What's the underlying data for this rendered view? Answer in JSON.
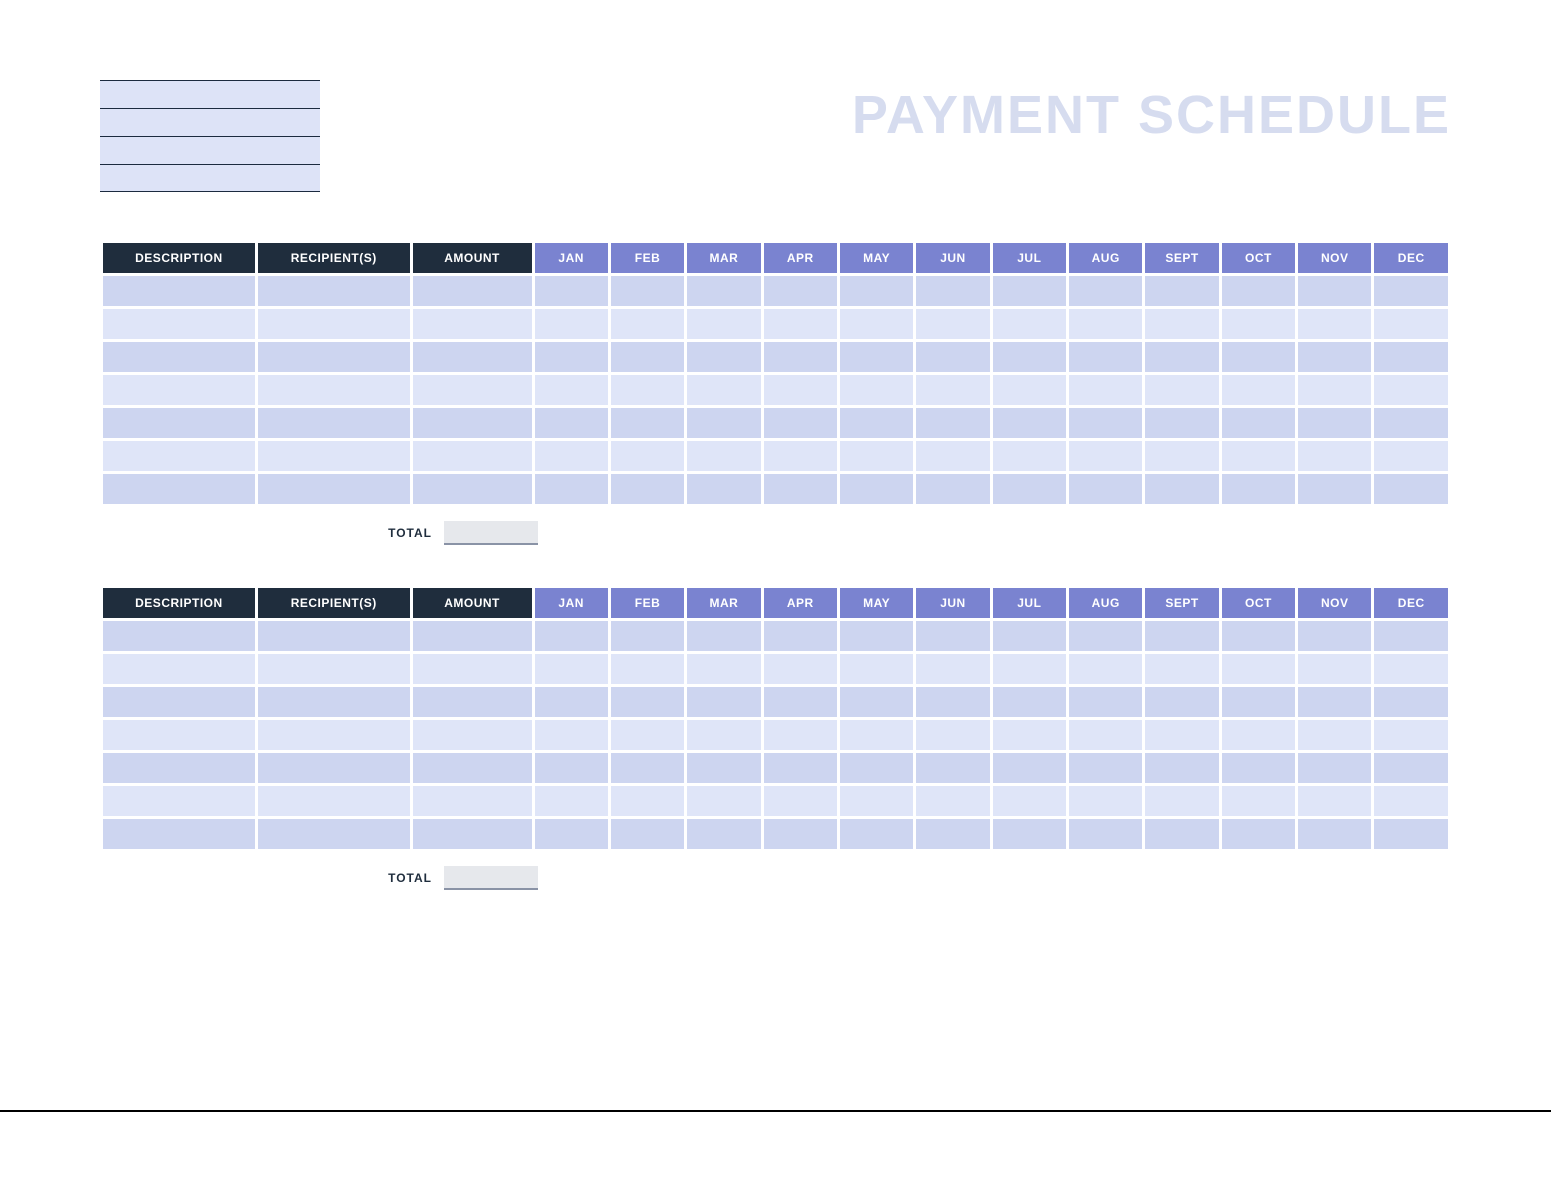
{
  "title": "PAYMENT SCHEDULE",
  "info_lines": [
    "",
    "",
    "",
    ""
  ],
  "columns": {
    "description": "DESCRIPTION",
    "recipients": "RECIPIENT(S)",
    "amount": "AMOUNT",
    "months": [
      "JAN",
      "FEB",
      "MAR",
      "APR",
      "MAY",
      "JUN",
      "JUL",
      "AUG",
      "SEPT",
      "OCT",
      "NOV",
      "DEC"
    ]
  },
  "tables": [
    {
      "rows": [
        {
          "description": "",
          "recipients": "",
          "amount": "",
          "months": [
            "",
            "",
            "",
            "",
            "",
            "",
            "",
            "",
            "",
            "",
            "",
            ""
          ]
        },
        {
          "description": "",
          "recipients": "",
          "amount": "",
          "months": [
            "",
            "",
            "",
            "",
            "",
            "",
            "",
            "",
            "",
            "",
            "",
            ""
          ]
        },
        {
          "description": "",
          "recipients": "",
          "amount": "",
          "months": [
            "",
            "",
            "",
            "",
            "",
            "",
            "",
            "",
            "",
            "",
            "",
            ""
          ]
        },
        {
          "description": "",
          "recipients": "",
          "amount": "",
          "months": [
            "",
            "",
            "",
            "",
            "",
            "",
            "",
            "",
            "",
            "",
            "",
            ""
          ]
        },
        {
          "description": "",
          "recipients": "",
          "amount": "",
          "months": [
            "",
            "",
            "",
            "",
            "",
            "",
            "",
            "",
            "",
            "",
            "",
            ""
          ]
        },
        {
          "description": "",
          "recipients": "",
          "amount": "",
          "months": [
            "",
            "",
            "",
            "",
            "",
            "",
            "",
            "",
            "",
            "",
            "",
            ""
          ]
        },
        {
          "description": "",
          "recipients": "",
          "amount": "",
          "months": [
            "",
            "",
            "",
            "",
            "",
            "",
            "",
            "",
            "",
            "",
            "",
            ""
          ]
        }
      ],
      "total_label": "TOTAL",
      "total_value": ""
    },
    {
      "rows": [
        {
          "description": "",
          "recipients": "",
          "amount": "",
          "months": [
            "",
            "",
            "",
            "",
            "",
            "",
            "",
            "",
            "",
            "",
            "",
            ""
          ]
        },
        {
          "description": "",
          "recipients": "",
          "amount": "",
          "months": [
            "",
            "",
            "",
            "",
            "",
            "",
            "",
            "",
            "",
            "",
            "",
            ""
          ]
        },
        {
          "description": "",
          "recipients": "",
          "amount": "",
          "months": [
            "",
            "",
            "",
            "",
            "",
            "",
            "",
            "",
            "",
            "",
            "",
            ""
          ]
        },
        {
          "description": "",
          "recipients": "",
          "amount": "",
          "months": [
            "",
            "",
            "",
            "",
            "",
            "",
            "",
            "",
            "",
            "",
            "",
            ""
          ]
        },
        {
          "description": "",
          "recipients": "",
          "amount": "",
          "months": [
            "",
            "",
            "",
            "",
            "",
            "",
            "",
            "",
            "",
            "",
            "",
            ""
          ]
        },
        {
          "description": "",
          "recipients": "",
          "amount": "",
          "months": [
            "",
            "",
            "",
            "",
            "",
            "",
            "",
            "",
            "",
            "",
            "",
            ""
          ]
        },
        {
          "description": "",
          "recipients": "",
          "amount": "",
          "months": [
            "",
            "",
            "",
            "",
            "",
            "",
            "",
            "",
            "",
            "",
            "",
            ""
          ]
        }
      ],
      "total_label": "TOTAL",
      "total_value": ""
    }
  ]
}
